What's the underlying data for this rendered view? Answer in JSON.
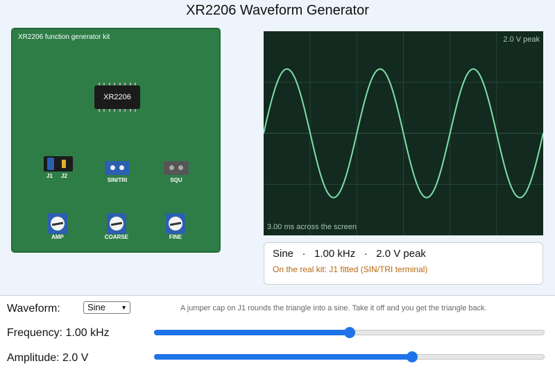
{
  "title": "XR2206 Waveform Generator",
  "board": {
    "label": "XR2206 function generator kit",
    "chip": "XR2206",
    "jumper_labels": [
      "J1",
      "J2"
    ],
    "terminals": [
      "SIN/TRI",
      "SQU"
    ],
    "pots": [
      "AMP",
      "COARSE",
      "FINE"
    ]
  },
  "scope": {
    "top_readout": "2.0 V peak",
    "bottom_readout": "3.00 ms across the screen",
    "cycles_on_screen": 3,
    "peak_fraction_of_half_height": 0.63,
    "trace_color": "#7ee0a8"
  },
  "info": {
    "main": "Sine   ·   1.00 kHz   ·   2.0 V peak",
    "note": "On the real kit: J1 fitted (SIN/TRI terminal)"
  },
  "controls": {
    "waveform_label": "Waveform:",
    "waveform_value": "Sine",
    "hint": "A jumper cap on J1 rounds the triangle into a sine. Take it off and you get the triangle back.",
    "frequency_label": "Frequency: 1.00 kHz",
    "frequency_fraction": 0.5,
    "amplitude_label": "Amplitude: 2.0 V",
    "amplitude_fraction": 0.66
  },
  "colors": {
    "board": "#2e7d46",
    "accent": "#1f73e8",
    "note": "#b5650d"
  }
}
